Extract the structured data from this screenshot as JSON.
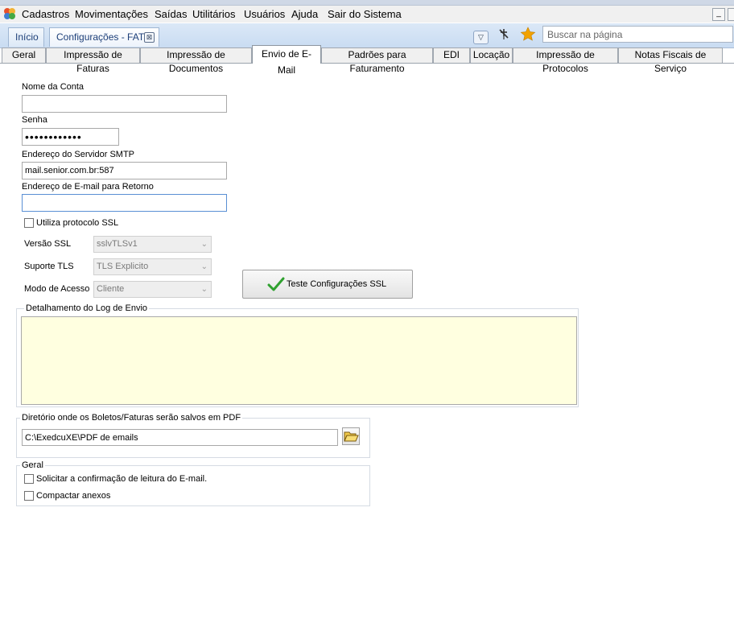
{
  "menu": {
    "items": [
      "Cadastros",
      "Movimentações",
      "Saídas",
      "Utilitários",
      "Usuários",
      "Ajuda",
      "Sair do Sistema"
    ],
    "minimize_label": "_"
  },
  "page_tabs": {
    "home": "Início",
    "config": "Configurações - FAT",
    "close_glyph": "⊠"
  },
  "search": {
    "placeholder": "Buscar na página",
    "value": ""
  },
  "settings_tabs": [
    "Geral",
    "Impressão de Faturas",
    "Impressão de Documentos",
    "Envio de E-Mail",
    "Padrões para Faturamento",
    "EDI",
    "Locação",
    "Impressão de Protocolos",
    "Notas Fiscais de Serviço"
  ],
  "active_tab": "Envio de E-Mail",
  "form": {
    "account_label": "Nome da Conta",
    "account_value": "",
    "password_label": "Senha",
    "password_value": "••••••••••••",
    "smtp_label": "Endereço do Servidor SMTP",
    "smtp_value": "mail.senior.com.br:587",
    "return_label": "Endereço de E-mail para Retorno",
    "return_value": "",
    "ssl_label": "Utiliza protocolo SSL",
    "ssl_checked": false,
    "ssl_version_label": "Versão SSL",
    "ssl_version_value": "sslvTLSv1",
    "tls_label": "Suporte TLS",
    "tls_value": "TLS Explicito",
    "access_label": "Modo de Acesso",
    "access_value": "Cliente",
    "test_button": "Teste Configurações SSL"
  },
  "log": {
    "title": "Detalhamento do Log de Envio",
    "content": ""
  },
  "pdf": {
    "title": "Diretório onde os Boletos/Faturas serão salvos em PDF",
    "path": "C:\\ExedcuXE\\PDF de emails"
  },
  "general": {
    "title": "Geral",
    "read_confirmation": "Solicitar a confirmação de leitura do E-mail.",
    "compress": "Compactar anexos"
  },
  "colors": {
    "log_background": "#ffffe0",
    "tab_text": "#1d3f78",
    "check_green": "#2fa12f",
    "star": "#f2a200"
  }
}
